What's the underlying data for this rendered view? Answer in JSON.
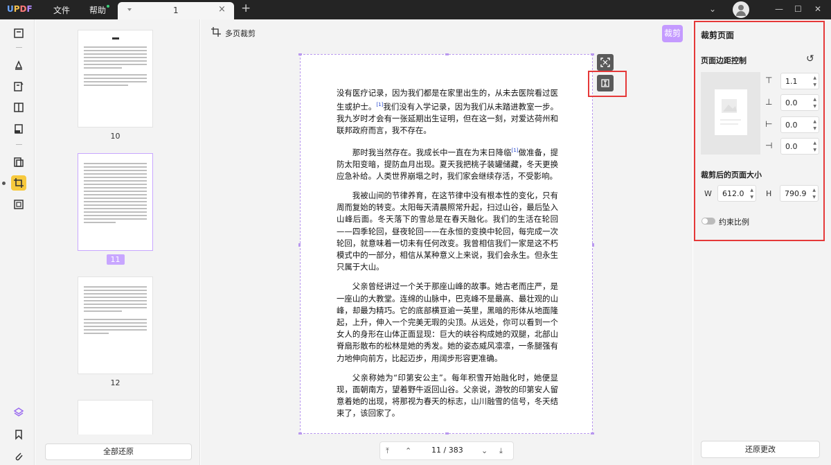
{
  "app": {
    "logo": "UPDF"
  },
  "menu": {
    "file": "文件",
    "help": "帮助"
  },
  "tab": {
    "name": "1"
  },
  "toolbar": {
    "title": "多页裁剪",
    "crop_button": "裁剪"
  },
  "thumbnails": [
    {
      "page": "10",
      "selected": false
    },
    {
      "page": "11",
      "selected": true
    },
    {
      "page": "12",
      "selected": false
    }
  ],
  "restore_all": "全部还原",
  "document": {
    "paragraphs": [
      {
        "before": "没有医疗记录，因为我们都是在家里出生的，从未去医院看过医生或护士。",
        "ref": "[1]",
        "after": "我们没有入学记录，因为我们从未踏进教室一步。我九岁时才会有一张延期出生证明，但在这一刻，对爱达荷州和联邦政府而言，我不存在。"
      },
      {
        "before": "那时我当然存在。我成长中一直在为末日降临",
        "ref": "[1]",
        "after": "做准备，提防太阳变暗，提防血月出现。夏天我把桃子装罐储藏，冬天更换应急补给。人类世界崩塌之时，我们家会继续存活，不受影响。"
      },
      {
        "before": "我被山间的节律养育，在这节律中没有根本性的变化，只有周而复始的转变。太阳每天清晨照常升起，扫过山谷，最后坠入山峰后面。冬天落下的雪总是在春天融化。我们的生活在轮回——四季轮回，昼夜轮回——在永恒的变换中轮回，每完成一次轮回，就意味着一切未有任何改变。我曾相信我们一家是这不朽模式中的一部分，相信从某种意义上来说，我们会永生。但永生只属于大山。",
        "ref": "",
        "after": ""
      },
      {
        "before": "父亲曾经讲过一个关于那座山峰的故事。她古老而庄严，是一座山的大教堂。连绵的山脉中，巴克峰不是最高、最壮观的山峰，却最为精巧。它的底部横亘逾一英里，黑暗的形体从地面隆起，上升，伸入一个完美无瑕的尖顶。从远处，你可以看到一个女人的身形在山体正面显现：巨大的峡谷构成她的双腿，北部山脊扇形散布的松林是她的秀发。她的姿态威风凛凛，一条腿强有力地伸向前方，比起迈步，用阔步形容更准确。",
        "ref": "",
        "after": ""
      },
      {
        "before": "父亲称她为“印第安公主”。每年积雪开始融化时，她便显现，面朝南方，望着野牛返回山谷。父亲说，游牧的印第安人留意着她的出现，将那视为春天的标志，山川融雪的信号，冬天结束了，该回家了。",
        "ref": "",
        "after": ""
      }
    ]
  },
  "pager": {
    "current": "11",
    "separator": "/",
    "total": "383"
  },
  "panel": {
    "title": "裁剪页面",
    "margin_title": "页面边距控制",
    "margins": [
      {
        "name": "top",
        "value": "1.1"
      },
      {
        "name": "bottom",
        "value": "0.0"
      },
      {
        "name": "left",
        "value": "0.0"
      },
      {
        "name": "right",
        "value": "0.0"
      }
    ],
    "size_title": "裁剪后的页面大小",
    "width_label": "W",
    "width": "612.0",
    "height_label": "H",
    "height": "790.9",
    "constrain_label": "约束比例",
    "constrain_on": false,
    "restore": "还原更改"
  },
  "colors": {
    "accent": "#c49aff",
    "highlight": "#e53838",
    "tool_active": "#f7c93d"
  }
}
